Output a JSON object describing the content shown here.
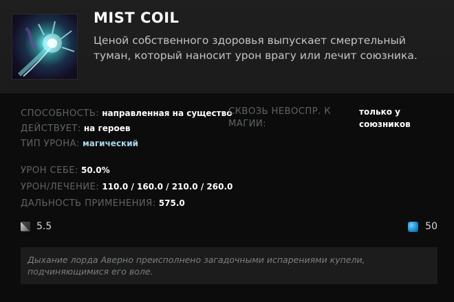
{
  "ability": {
    "name": "MIST COIL",
    "icon": "mist-coil-icon",
    "description": "Ценой собственного здоровья выпускает смертельный туман, который наносит урон врагу или лечит союзника."
  },
  "attributes": {
    "ability_key": "СПОСОБНОСТЬ:",
    "ability_val": "направленная на существо",
    "affects_key": "ДЕЙСТВУЕТ:",
    "affects_val": "на героев",
    "damage_type_key": "ТИП УРОНА:",
    "damage_type_val": "магический",
    "pierce_key": "СКВОЗЬ НЕВОСПР. К МАГИИ:",
    "pierce_val": "только у союзников"
  },
  "values": {
    "self_damage_key": "УРОН СЕБЕ:",
    "self_damage_val": "50.0%",
    "damage_heal_key": "УРОН/ЛЕЧЕНИЕ:",
    "damage_heal_val": "110.0 / 160.0 / 210.0 / 260.0",
    "cast_range_key": "ДАЛЬНОСТЬ ПРИМЕНЕНИЯ:",
    "cast_range_val": "575.0"
  },
  "cooldown": {
    "icon": "cooldown-icon",
    "value": "5.5"
  },
  "mana": {
    "icon": "mana-icon",
    "value": "50",
    "color": "#1e8fd0"
  },
  "lore": "Дыхание лорда Аверно преисполнено загадочными испарениями купели, подчиняющимися его воле."
}
